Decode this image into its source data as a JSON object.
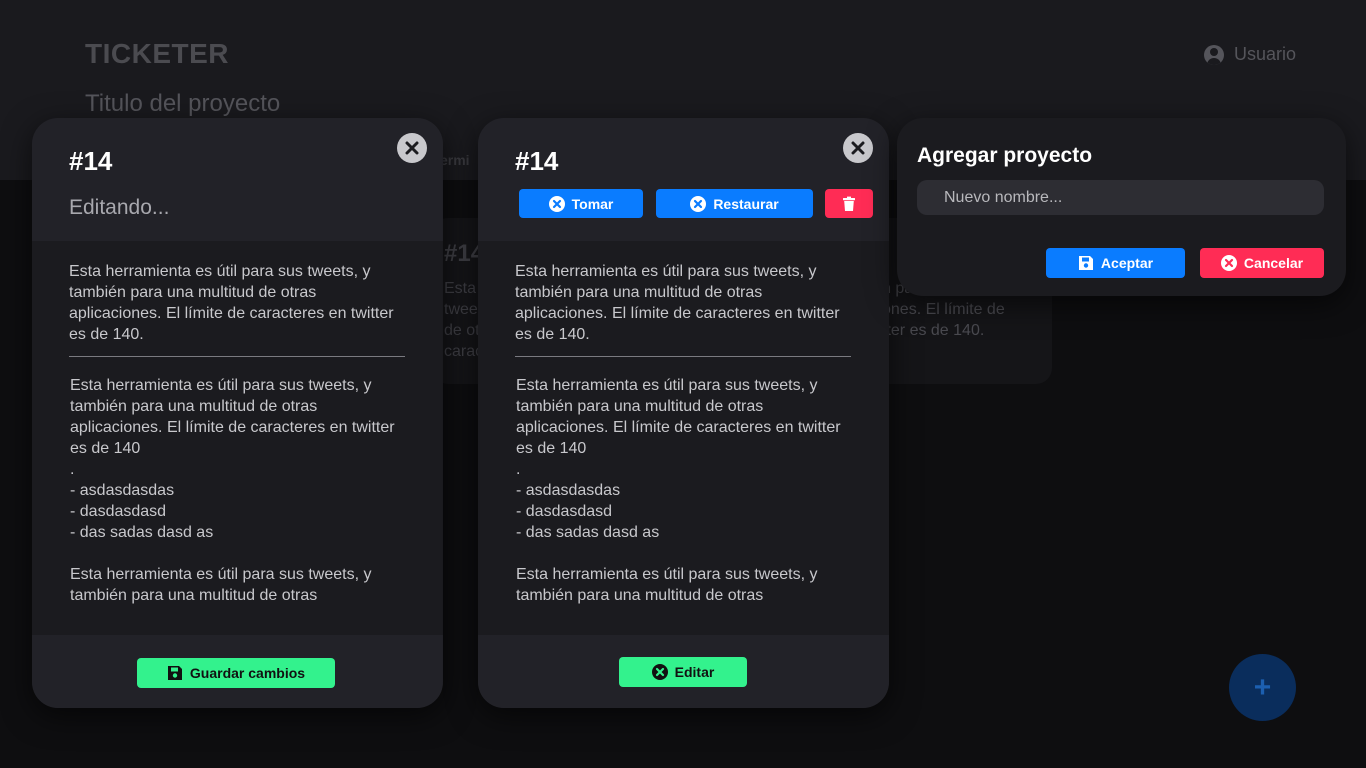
{
  "header": {
    "app_title": "TICKETER",
    "project_title": "Titulo del proyecto",
    "user_label": "Usuario",
    "tab_partial": "ermi"
  },
  "background_card": {
    "number": "#14",
    "text_left": "Esta\ntwee\nde ot\ncarac",
    "text_right": "n para una multitud\nones. El límite de\ntter es de 140."
  },
  "fab": {
    "label": "+"
  },
  "edit_modal": {
    "number": "#14",
    "status": "Editando...",
    "description": "Esta herramienta es útil para sus tweets, y también para una multitud de otras aplicaciones. El límite de caracteres en twitter es de 140.",
    "comments": "Esta herramienta es útil para sus tweets, y también para una multitud de otras aplicaciones. El límite de caracteres en twitter es de 140\n.\n- asdasdasdas\n- dasdasdasd\n- das sadas dasd as\n\nEsta herramienta es útil para sus tweets, y también para una multitud de otras",
    "save_label": "Guardar cambios"
  },
  "view_modal": {
    "number": "#14",
    "take_label": "Tomar",
    "restore_label": "Restaurar",
    "description": "Esta herramienta es útil para sus tweets, y también para una multitud de otras aplicaciones. El límite de caracteres en twitter es de 140.",
    "comments": "Esta herramienta es útil para sus tweets, y también para una multitud de otras aplicaciones. El límite de caracteres en twitter es de 140\n.\n- asdasdasdas\n- dasdasdasd\n- das sadas dasd as\n\nEsta herramienta es útil para sus tweets, y también para una multitud de otras",
    "edit_label": "Editar"
  },
  "add_project_modal": {
    "title": "Agregar proyecto",
    "input_placeholder": "Nuevo nombre...",
    "input_value": "",
    "accept_label": "Aceptar",
    "cancel_label": "Cancelar"
  },
  "colors": {
    "green": "#33f28d",
    "blue": "#0a7cff",
    "red": "#ff2c55",
    "panel": "#1b1b1f"
  }
}
